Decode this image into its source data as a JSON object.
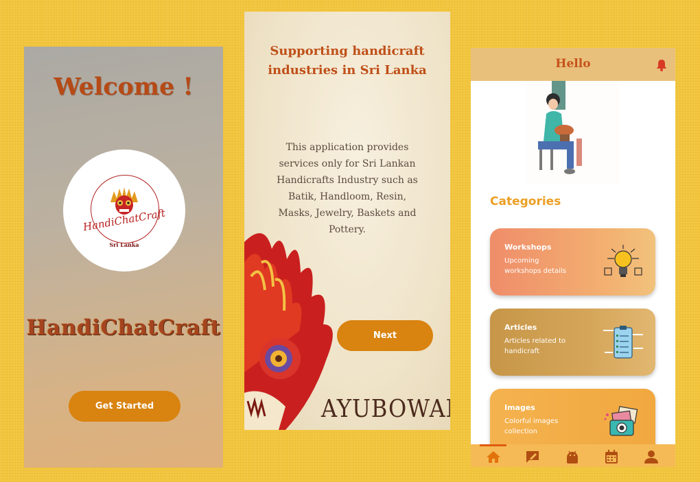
{
  "screen1": {
    "title": "Welcome !",
    "logo": {
      "word": "HandiChatCraft",
      "sub": "Sri Lanka"
    },
    "brand": "HandiChatCraft",
    "cta": "Get Started"
  },
  "screen2": {
    "heading": "Supporting handicraft industries in Sri Lanka",
    "description": "This application provides services only for Sri Lankan Handicrafts Industry such as Batik, Handloom, Resin, Masks, Jewelry, Baskets and Pottery.",
    "next": "Next",
    "ayubowan": "AYUBOWAN"
  },
  "screen3": {
    "header": "Hello",
    "header_icon": "bell-icon",
    "categories_title": "Categories",
    "cards": [
      {
        "title": "Workshops",
        "desc": "Upcoming workshops details",
        "icon": "lightbulb-icon"
      },
      {
        "title": "Articles",
        "desc": "Articles related to handicraft",
        "icon": "clipboard-icon"
      },
      {
        "title": "Images",
        "desc": "Colorful images collection",
        "icon": "camera-photos-icon"
      }
    ],
    "nav": [
      "home-icon",
      "edit-icon",
      "android-icon",
      "calendar-icon",
      "person-icon"
    ],
    "active_nav": "home-icon"
  },
  "colors": {
    "accent": "#d98310",
    "title": "#b64a17",
    "category": "#eb9f24",
    "navbar": "#f5ba55"
  }
}
